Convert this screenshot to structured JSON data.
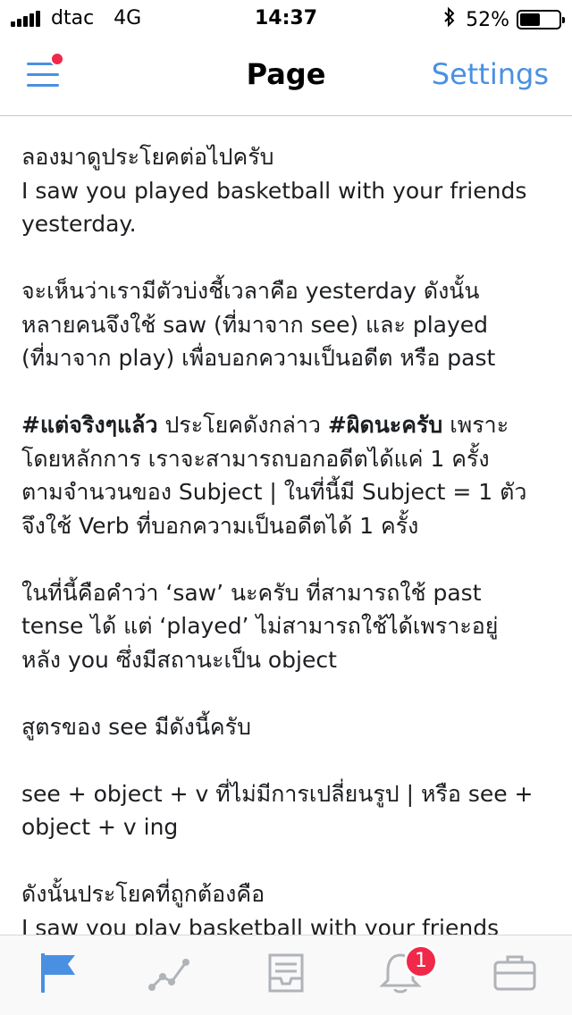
{
  "status": {
    "carrier": "dtac",
    "network": "4G",
    "time": "14:37",
    "battery": "52%",
    "battery_level": 0.52
  },
  "nav": {
    "title": "Page",
    "settings": "Settings"
  },
  "content": {
    "paragraphs": [
      [
        "ลองมาดูประโยคต่อไปครับ",
        "I saw you played basketball with your friends",
        "yesterday."
      ],
      [
        "จะเห็นว่าเรามีตัวบ่งชี้เวลาคือ yesterday ดังนั้น",
        "หลายคนจึงใช้ saw (ที่มาจาก see) และ played",
        "(ที่มาจาก play) เพื่อบอกความเป็นอดีต หรือ past"
      ],
      [
        "ประโยคดังกล่าว",
        "เพราะ",
        "โดยหลักการ เราจะสามารถบอกอดีตได้แค่ 1 ครั้ง",
        "ตามจำนวนของ Subject | ในที่นี้มี Subject = 1 ตัว",
        "จึงใช้ Verb ที่บอกความเป็นอดีตได้ 1 ครั้ง"
      ],
      [
        "ในที่นี้คือคำว่า ‘saw’ นะครับ ที่สามารถใช้ past",
        "tense ได้ แต่ ‘played’ ไม่สามารถใช้ได้เพราะอยู่",
        "หลัง you ซึ่งมีสถานะเป็น object"
      ],
      [
        "สูตรของ see มีดังนี้ครับ"
      ],
      [
        "see + object + v ที่ไม่มีการเปลี่ยนรูป | หรือ see +",
        "object + v ing"
      ],
      [
        "ดังนั้นประโยคที่ถูกต้องคือ",
        "I saw you play basketball with your friends"
      ]
    ],
    "hashtags": {
      "first": "#แต่จริงๆแล้ว",
      "second": "#ผิดนะครับ"
    }
  },
  "tabs": {
    "notifications_badge": "1",
    "active_color": "#4a90e2",
    "inactive_color": "#b0b3b8"
  }
}
